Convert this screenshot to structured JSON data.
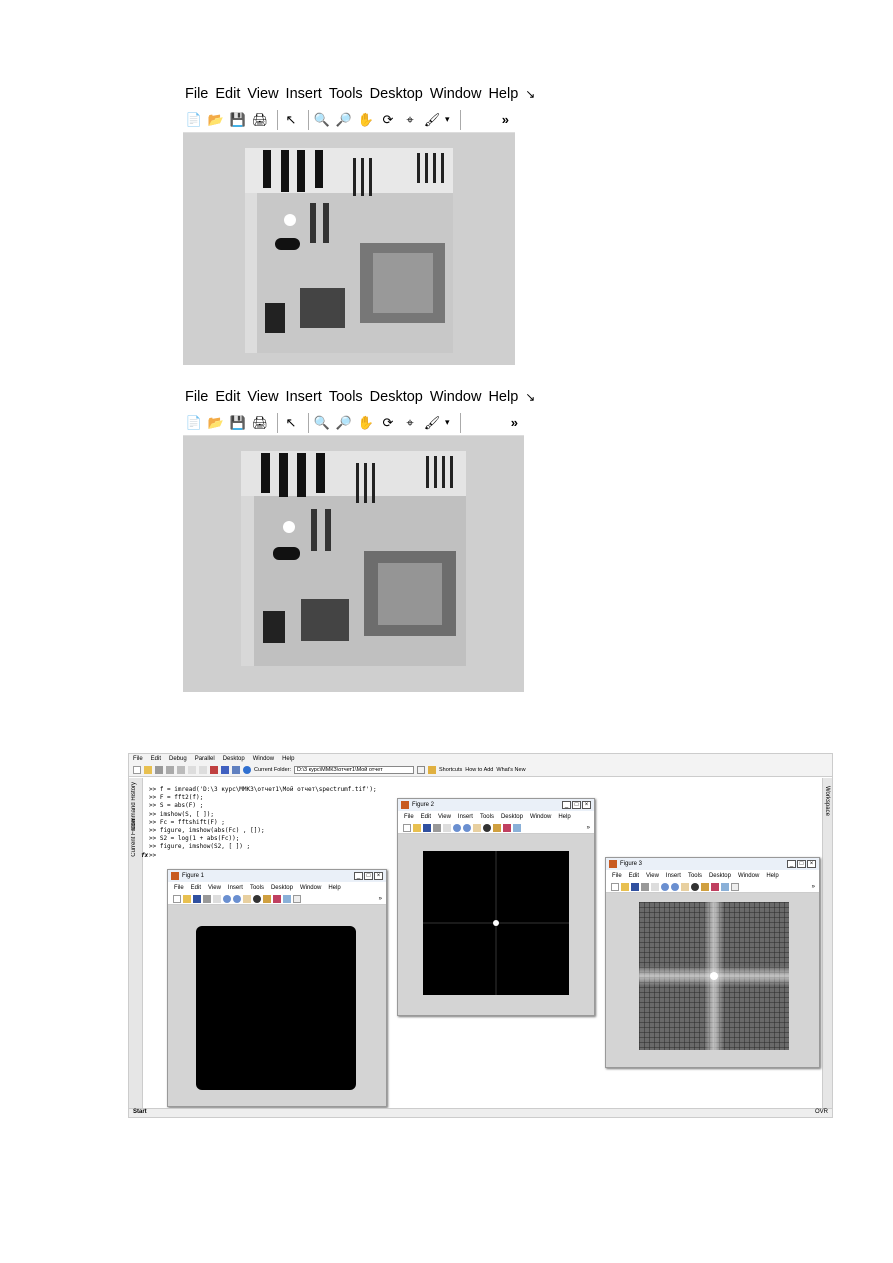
{
  "figure_top": {
    "menu": [
      "File",
      "Edit",
      "View",
      "Insert",
      "Tools",
      "Desktop",
      "Window",
      "Help"
    ],
    "menu_arrow": "↘",
    "toolbar_more": "»"
  },
  "figure_bottom": {
    "menu": [
      "File",
      "Edit",
      "View",
      "Insert",
      "Tools",
      "Desktop",
      "Window",
      "Help"
    ],
    "menu_arrow": "↘",
    "toolbar_more": "»"
  },
  "matlab": {
    "menu": [
      "File",
      "Edit",
      "Debug",
      "Parallel",
      "Desktop",
      "Window",
      "Help"
    ],
    "current_folder_label": "Current Folder:",
    "current_folder_value": "D:\\3 курс\\ММКЗ\\отчет1\\Мой отчет",
    "shortcuts": [
      "Shortcuts",
      "How to Add",
      "What's New"
    ],
    "side_labels": [
      "Current Folder",
      "Command History"
    ],
    "right_label": "Workspace",
    "commands": [
      ">> f = imread('D:\\3 курс\\ММКЗ\\отчет1\\Мой отчет\\spectrumf.tif');",
      ">> F = fft2(f);",
      ">> S = abs(F) ;",
      ">> imshow(S, [ ]);",
      ">> Fc = fftshift(F) ;",
      ">> figure, imshow(abs(Fc) , []);",
      ">> S2 = log(1 + abs(Fc));",
      ">> figure, imshow(S2, [ ]) ;",
      ">>"
    ],
    "prompt_fx": "fx",
    "start": "Start",
    "ovr": "OVR",
    "figures": [
      {
        "title": "Figure 1"
      },
      {
        "title": "Figure 2"
      },
      {
        "title": "Figure 3"
      }
    ],
    "fig_menu": [
      "File",
      "Edit",
      "View",
      "Insert",
      "Tools",
      "Desktop",
      "Window",
      "Help"
    ],
    "fig_more": "»"
  }
}
